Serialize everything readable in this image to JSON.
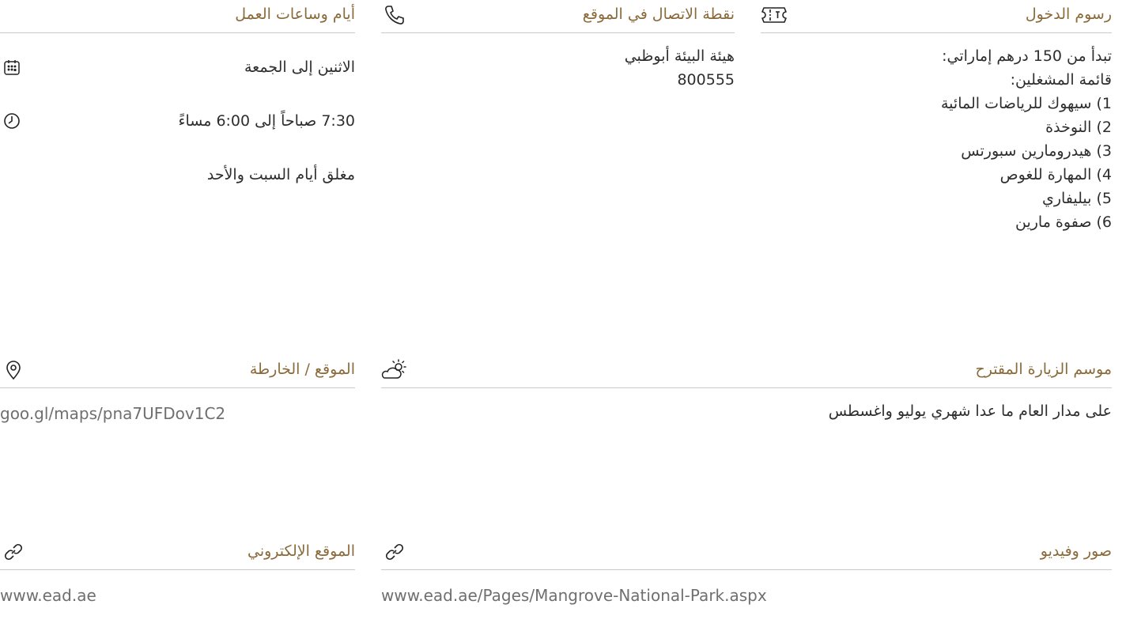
{
  "entry_fees": {
    "title": "رسوم الدخول",
    "icon": "ticket-icon",
    "lines": [
      "تبدأ من 150 درهم إماراتي:",
      "قائمة المشغلين:",
      "1) سيهوك للرياضات المائية",
      "2) النوخذة",
      "3) هيدرومارين سبورتس",
      "4) المهارة للغوص",
      "5) بيليفاري",
      "6) صفوة مارين"
    ]
  },
  "contact": {
    "title": "نقطة الاتصال في الموقع",
    "icon": "phone-icon",
    "lines": [
      "هيئة البيئة أبوظبي",
      "800555"
    ]
  },
  "hours": {
    "title": "أيام وساعات العمل",
    "days": "الاثنين إلى الجمعة",
    "days_icon": "calendar-icon",
    "time": "7:30 صباحاً إلى 6:00 مساءً",
    "time_icon": "clock-icon",
    "closed": "مغلق أيام السبت والأحد"
  },
  "season": {
    "title": "موسم الزيارة المقترح",
    "icon": "partly-cloudy-icon",
    "text": "على مدار العام ما عدا شهري يوليو واغسطس"
  },
  "location": {
    "title": "الموقع / الخارطة",
    "icon": "map-pin-icon",
    "link": "goo.gl/maps/pna7UFDov1C2"
  },
  "media": {
    "title": "صور وفيديو",
    "icon": "link-icon",
    "link": "www.ead.ae/Pages/Mangrove-National-Park.aspx"
  },
  "website": {
    "title": "الموقع الإلكتروني",
    "icon": "link-icon",
    "link": "www.ead.ae"
  },
  "colors": {
    "heading": "#8a6a3a",
    "body_text": "#2e2e2e",
    "link_text": "#6f6f6f",
    "divider": "#c9c9c9"
  }
}
